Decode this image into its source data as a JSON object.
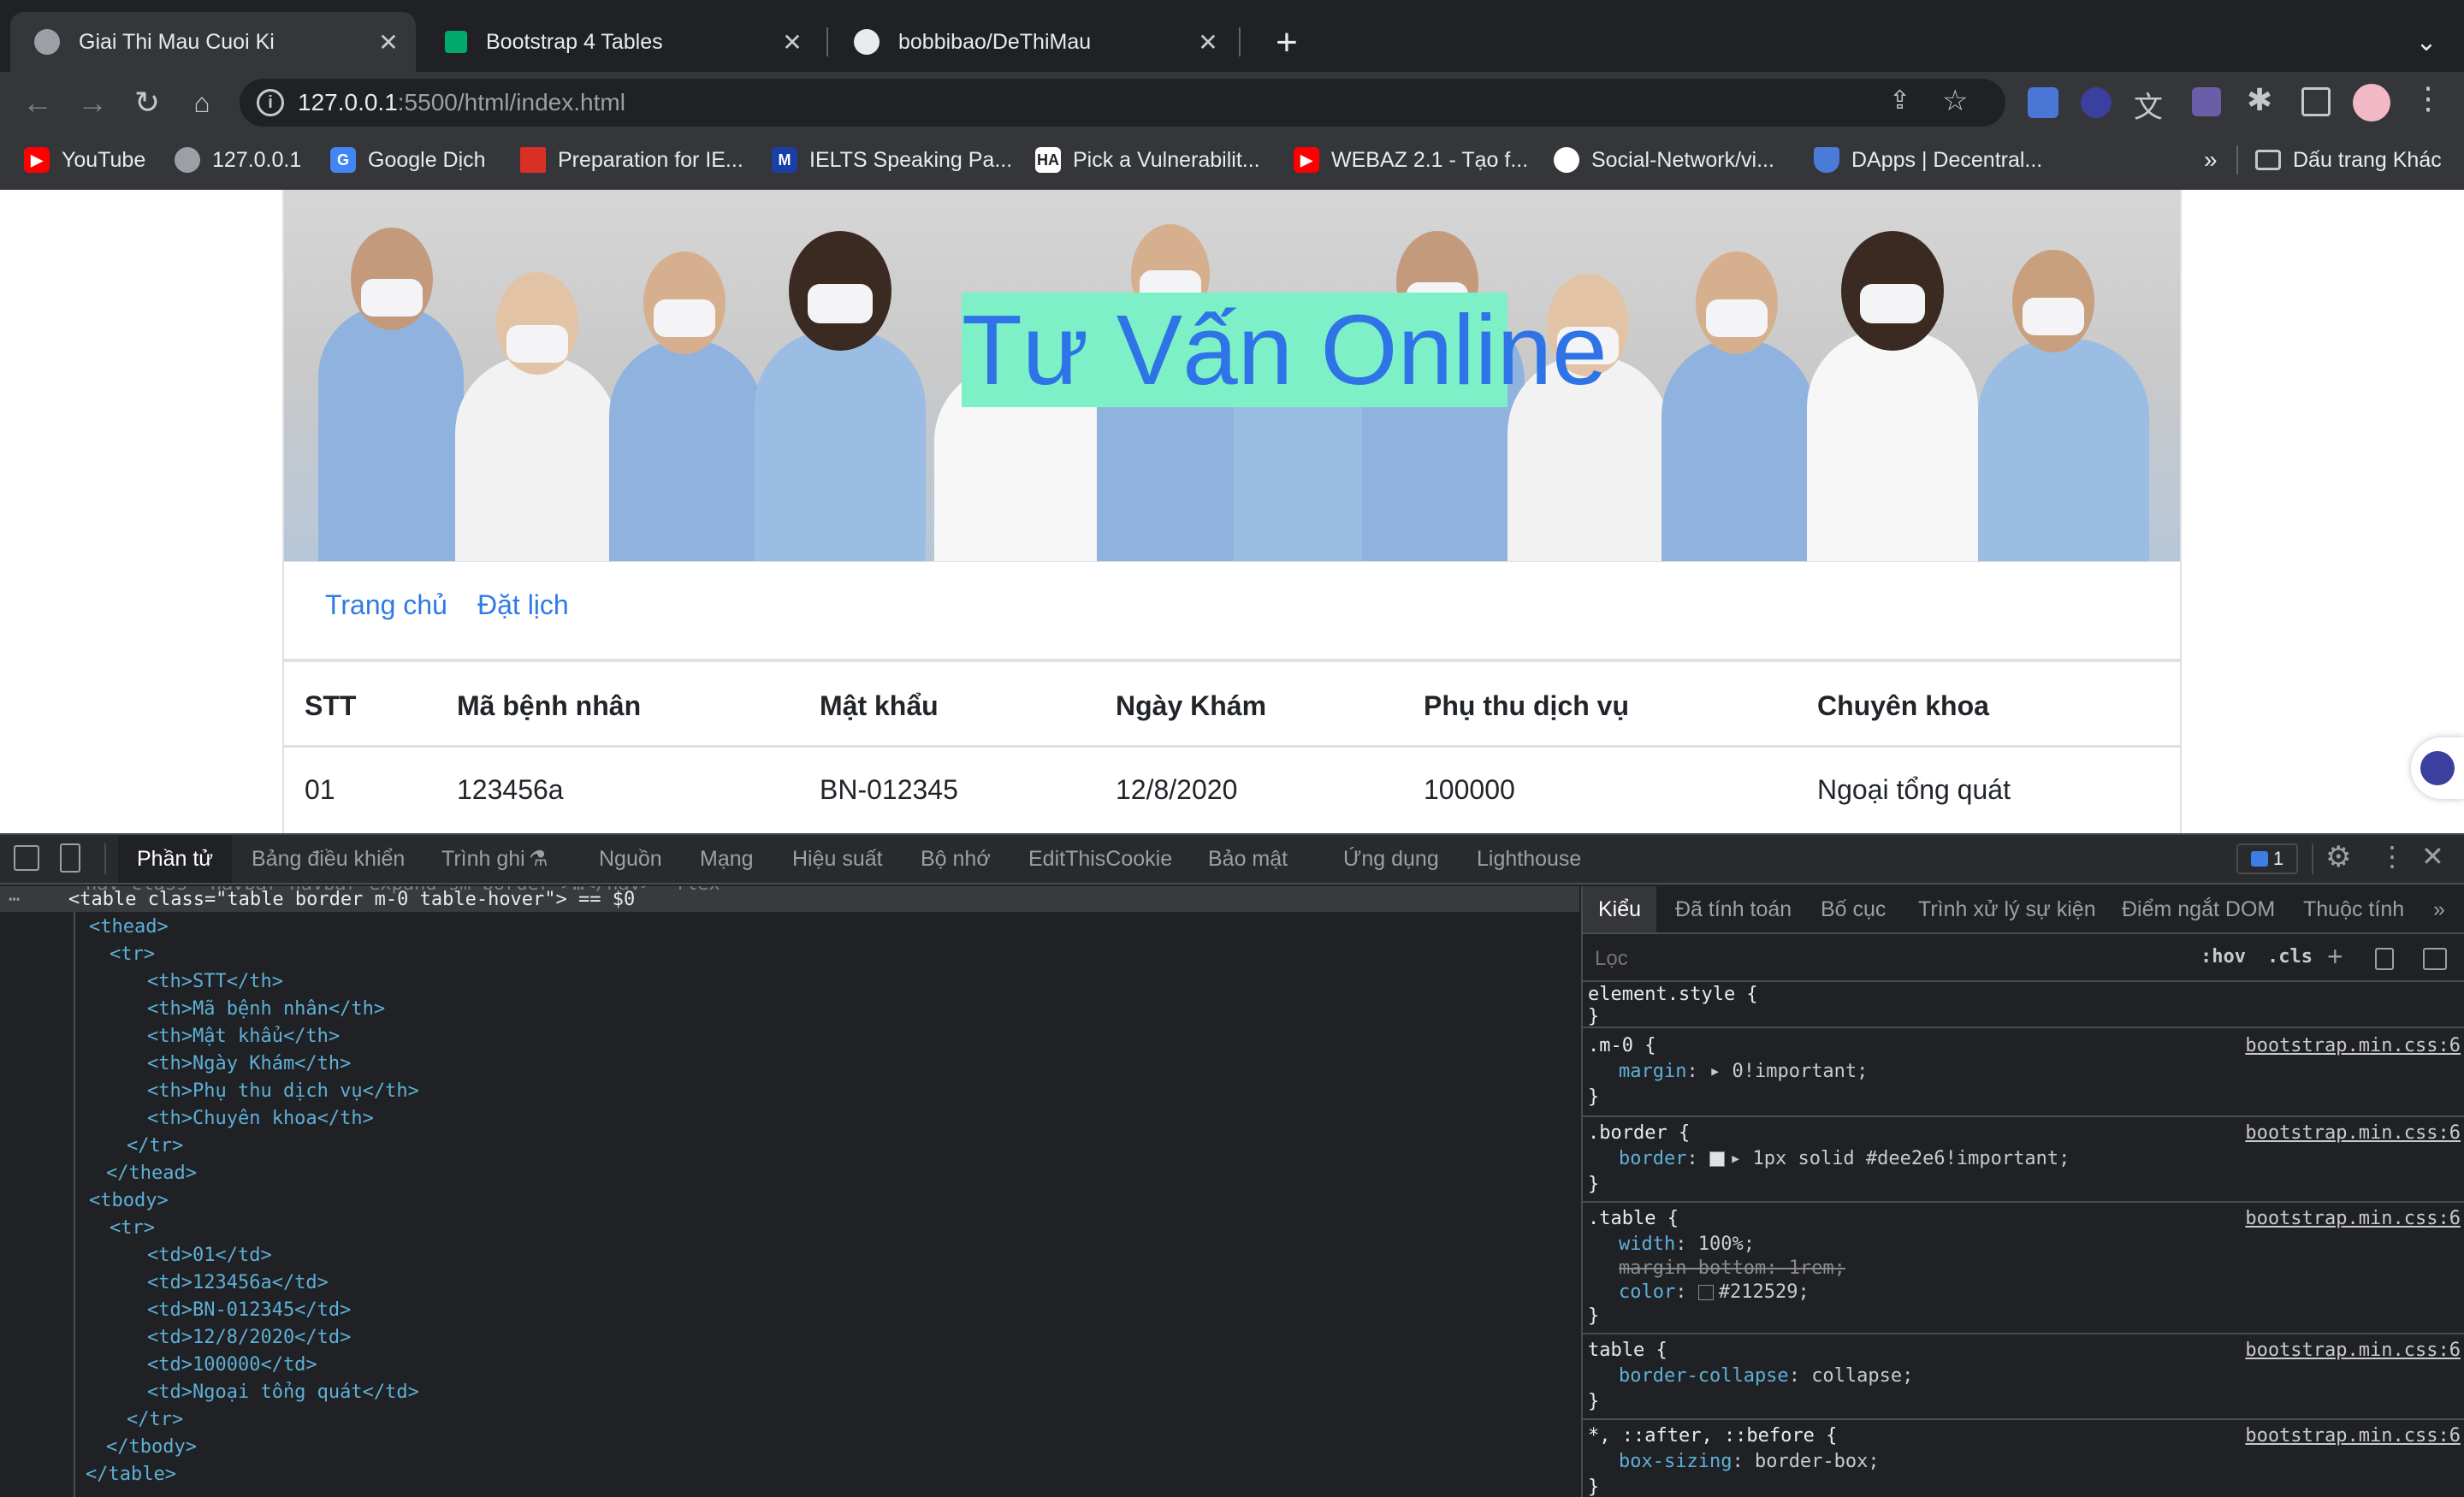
{
  "tabs": [
    {
      "title": "Giai Thi Mau Cuoi Ki",
      "icon": "globe-icon"
    },
    {
      "title": "Bootstrap 4 Tables",
      "icon": "w3schools-icon"
    },
    {
      "title": "bobbibao/DeThiMau",
      "icon": "github-icon"
    }
  ],
  "address": {
    "host": "127.0.0.1",
    "rest": ":5500/html/index.html"
  },
  "bookmarks": [
    {
      "label": "YouTube",
      "color": "#ff0000"
    },
    {
      "label": "127.0.0.1",
      "color": "#9aa0a6"
    },
    {
      "label": "Google Dịch",
      "color": "#4285f4"
    },
    {
      "label": "Preparation for IE...",
      "color": "#d93025"
    },
    {
      "label": "IELTS Speaking Pa...",
      "color": "#1a3fa8"
    },
    {
      "label": "Pick a Vulnerabilit...",
      "color": "#ffffff"
    },
    {
      "label": "WEBAZ 2.1 - Tạo f...",
      "color": "#ff0000"
    },
    {
      "label": "Social-Network/vi...",
      "color": "#ffffff"
    },
    {
      "label": "DApps | Decentral...",
      "color": "#4a7bd8"
    }
  ],
  "bookmarks_more": "»",
  "bookmarks_other": "Dấu trang Khác",
  "page": {
    "banner_title": "Tư Vấn Online",
    "nav": [
      "Trang chủ",
      "Đặt lịch"
    ],
    "table": {
      "headers": [
        "STT",
        "Mã bệnh nhân",
        "Mật khẩu",
        "Ngày Khám",
        "Phụ thu dịch vụ",
        "Chuyên khoa"
      ],
      "rows": [
        [
          "01",
          "123456a",
          "BN-012345",
          "12/8/2020",
          "100000",
          "Ngoại tổng quát"
        ]
      ]
    }
  },
  "devtools": {
    "tabs": [
      "Phần tử",
      "Bảng điều khiển",
      "Trình ghi",
      "Nguồn",
      "Mạng",
      "Hiệu suất",
      "Bộ nhớ",
      "EditThisCookie",
      "Bảo mật",
      "Ứng dụng",
      "Lighthouse"
    ],
    "issues_count": "1",
    "dom_lines": [
      {
        "indent": 0,
        "text": "<table class=\"table border m-0 table-hover\"> == $0"
      },
      {
        "indent": 1,
        "text": "<thead>"
      },
      {
        "indent": 2,
        "text": "<tr>"
      },
      {
        "indent": 3,
        "text": "<th>STT</th>"
      },
      {
        "indent": 3,
        "text": "<th>Mã bệnh nhân</th>"
      },
      {
        "indent": 3,
        "text": "<th>Mật khẩu</th>"
      },
      {
        "indent": 3,
        "text": "<th>Ngày Khám</th>"
      },
      {
        "indent": 3,
        "text": "<th>Phụ thu dịch vụ</th>"
      },
      {
        "indent": 3,
        "text": "<th>Chuyên khoa</th>"
      },
      {
        "indent": 2,
        "text": "</tr>"
      },
      {
        "indent": 1,
        "text": "</thead>"
      },
      {
        "indent": 1,
        "text": "<tbody>"
      },
      {
        "indent": 2,
        "text": "<tr>"
      },
      {
        "indent": 3,
        "text": "<td>01</td>"
      },
      {
        "indent": 3,
        "text": "<td>123456a</td>"
      },
      {
        "indent": 3,
        "text": "<td>BN-012345</td>"
      },
      {
        "indent": 3,
        "text": "<td>12/8/2020</td>"
      },
      {
        "indent": 3,
        "text": "<td>100000</td>"
      },
      {
        "indent": 3,
        "text": "<td>Ngoại tổng quát</td>"
      },
      {
        "indent": 2,
        "text": "</tr>"
      },
      {
        "indent": 1,
        "text": "</tbody>"
      },
      {
        "indent": 0,
        "text": "</table>"
      }
    ],
    "styles_tabs": [
      "Kiểu",
      "Đã tính toán",
      "Bố cục",
      "Trình xử lý sự kiện",
      "Điểm ngắt DOM",
      "Thuộc tính"
    ],
    "filter_placeholder": "Lọc",
    "hov": ":hov",
    "cls": ".cls",
    "rules": [
      {
        "selector": "element.style {",
        "source": "",
        "props": []
      },
      {
        "selector": ".m-0 {",
        "source": "bootstrap.min.css:6",
        "props": [
          {
            "name": "margin",
            "value": "▸ 0!important;",
            "struck": false
          }
        ]
      },
      {
        "selector": ".border {",
        "source": "bootstrap.min.css:6",
        "props": [
          {
            "name": "border",
            "value": "▸ 1px solid #dee2e6!important;",
            "struck": false,
            "swatch": "#dee2e6"
          }
        ]
      },
      {
        "selector": ".table {",
        "source": "bootstrap.min.css:6",
        "props": [
          {
            "name": "width",
            "value": "100%;",
            "struck": false
          },
          {
            "name": "margin-bottom",
            "value": "1rem;",
            "struck": true
          },
          {
            "name": "color",
            "value": "#212529;",
            "struck": false,
            "swatch": "#212529"
          }
        ]
      },
      {
        "selector": "table {",
        "source": "bootstrap.min.css:6",
        "props": [
          {
            "name": "border-collapse",
            "value": "collapse;",
            "struck": false
          }
        ]
      },
      {
        "selector": "*, ::after, ::before {",
        "source": "bootstrap.min.css:6",
        "props": [
          {
            "name": "box-sizing",
            "value": "border-box;",
            "struck": false
          }
        ]
      }
    ]
  }
}
